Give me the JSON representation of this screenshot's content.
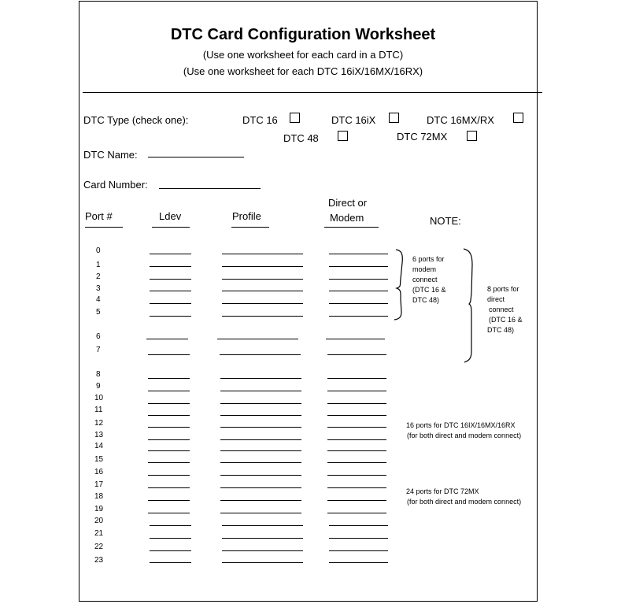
{
  "document": {
    "title": "DTC Card Configuration Worksheet",
    "subtitle_lines": [
      "(Use one worksheet for each card in a DTC)",
      "(Use one worksheet for each DTC 16iX/16MX/16RX)"
    ]
  },
  "dtc_type": {
    "label": "DTC Type (check one):",
    "options": [
      {
        "label": "DTC 16",
        "checked": false
      },
      {
        "label": "DTC 16iX",
        "checked": false
      },
      {
        "label": "DTC 16MX/RX",
        "checked": false
      },
      {
        "label": "DTC 48",
        "checked": false
      },
      {
        "label": "DTC 72MX",
        "checked": false
      }
    ]
  },
  "fields": {
    "dtc_name_label": "DTC Name:",
    "dtc_name_value": "",
    "card_number_label": "Card Number:",
    "card_number_value": ""
  },
  "table": {
    "headers": {
      "port": "Port #",
      "ldev": "Ldev",
      "profile": "Profile",
      "direct_or_modem_line1": "Direct or",
      "direct_or_modem_line2": "Modem",
      "note": "NOTE:"
    },
    "rows": [
      {
        "port": "0",
        "ldev": "",
        "profile": "",
        "direct_or_modem": ""
      },
      {
        "port": "1",
        "ldev": "",
        "profile": "",
        "direct_or_modem": ""
      },
      {
        "port": "2",
        "ldev": "",
        "profile": "",
        "direct_or_modem": ""
      },
      {
        "port": "3",
        "ldev": "",
        "profile": "",
        "direct_or_modem": ""
      },
      {
        "port": "4",
        "ldev": "",
        "profile": "",
        "direct_or_modem": ""
      },
      {
        "port": "5",
        "ldev": "",
        "profile": "",
        "direct_or_modem": ""
      },
      {
        "port": "6",
        "ldev": "",
        "profile": "",
        "direct_or_modem": ""
      },
      {
        "port": "7",
        "ldev": "",
        "profile": "",
        "direct_or_modem": ""
      },
      {
        "port": "8",
        "ldev": "",
        "profile": "",
        "direct_or_modem": ""
      },
      {
        "port": "9",
        "ldev": "",
        "profile": "",
        "direct_or_modem": ""
      },
      {
        "port": "10",
        "ldev": "",
        "profile": "",
        "direct_or_modem": ""
      },
      {
        "port": "11",
        "ldev": "",
        "profile": "",
        "direct_or_modem": ""
      },
      {
        "port": "12",
        "ldev": "",
        "profile": "",
        "direct_or_modem": ""
      },
      {
        "port": "13",
        "ldev": "",
        "profile": "",
        "direct_or_modem": ""
      },
      {
        "port": "14",
        "ldev": "",
        "profile": "",
        "direct_or_modem": ""
      },
      {
        "port": "15",
        "ldev": "",
        "profile": "",
        "direct_or_modem": ""
      },
      {
        "port": "16",
        "ldev": "",
        "profile": "",
        "direct_or_modem": ""
      },
      {
        "port": "17",
        "ldev": "",
        "profile": "",
        "direct_or_modem": ""
      },
      {
        "port": "18",
        "ldev": "",
        "profile": "",
        "direct_or_modem": ""
      },
      {
        "port": "19",
        "ldev": "",
        "profile": "",
        "direct_or_modem": ""
      },
      {
        "port": "20",
        "ldev": "",
        "profile": "",
        "direct_or_modem": ""
      },
      {
        "port": "21",
        "ldev": "",
        "profile": "",
        "direct_or_modem": ""
      },
      {
        "port": "22",
        "ldev": "",
        "profile": "",
        "direct_or_modem": ""
      },
      {
        "port": "23",
        "ldev": "",
        "profile": "",
        "direct_or_modem": ""
      }
    ]
  },
  "notes": {
    "modem_group": [
      "6 ports for",
      "modem",
      "connect",
      "(DTC 16 &",
      "DTC 48)"
    ],
    "direct_group": [
      "8 ports for",
      "direct",
      "connect",
      "(DTC 16 &",
      "DTC 48)"
    ],
    "dtc16_group": [
      "16 ports for DTC 16IX/16MX/16RX",
      "(for both direct and modem connect)"
    ],
    "dtc72_group": [
      "24 ports for DTC 72MX",
      "(for both direct and modem connect)"
    ]
  }
}
